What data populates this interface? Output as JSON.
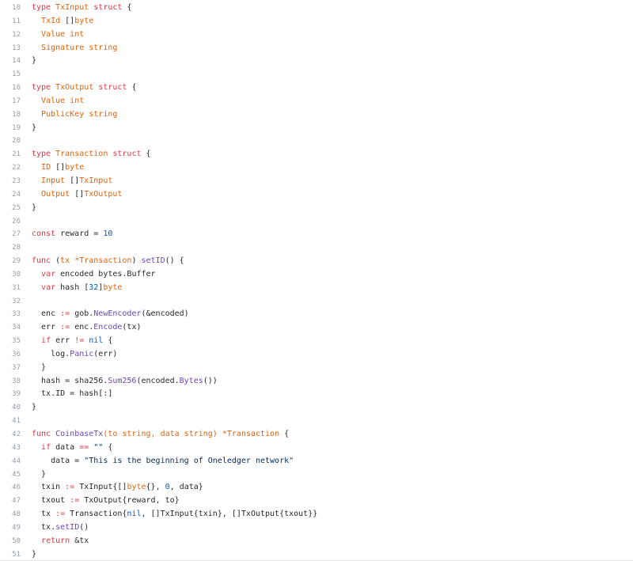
{
  "colors": {
    "keyword": "#d73a49",
    "type": "#e36209",
    "function": "#6f42c1",
    "string": "#032f62",
    "number": "#005cc5",
    "plain": "#24292e",
    "line_number": "#959da5"
  },
  "lines": [
    {
      "n": "10",
      "tokens": [
        [
          "kw",
          "type "
        ],
        [
          "ty",
          "TxInput "
        ],
        [
          "kw",
          "struct "
        ],
        [
          "pl",
          "{"
        ]
      ]
    },
    {
      "n": "11",
      "tokens": [
        [
          "pl",
          "  "
        ],
        [
          "ty",
          "TxId "
        ],
        [
          "pl",
          "[]"
        ],
        [
          "ty",
          "byte"
        ]
      ]
    },
    {
      "n": "12",
      "tokens": [
        [
          "pl",
          "  "
        ],
        [
          "ty",
          "Value "
        ],
        [
          "ty",
          "int"
        ]
      ]
    },
    {
      "n": "13",
      "tokens": [
        [
          "pl",
          "  "
        ],
        [
          "ty",
          "Signature "
        ],
        [
          "ty",
          "string"
        ]
      ]
    },
    {
      "n": "14",
      "tokens": [
        [
          "pl",
          "}"
        ]
      ]
    },
    {
      "n": "15",
      "tokens": []
    },
    {
      "n": "16",
      "tokens": [
        [
          "kw",
          "type "
        ],
        [
          "ty",
          "TxOutput "
        ],
        [
          "kw",
          "struct "
        ],
        [
          "pl",
          "{"
        ]
      ]
    },
    {
      "n": "17",
      "tokens": [
        [
          "pl",
          "  "
        ],
        [
          "ty",
          "Value "
        ],
        [
          "ty",
          "int"
        ]
      ]
    },
    {
      "n": "18",
      "tokens": [
        [
          "pl",
          "  "
        ],
        [
          "ty",
          "PublicKey "
        ],
        [
          "ty",
          "string"
        ]
      ]
    },
    {
      "n": "19",
      "tokens": [
        [
          "pl",
          "}"
        ]
      ]
    },
    {
      "n": "20",
      "tokens": []
    },
    {
      "n": "21",
      "tokens": [
        [
          "kw",
          "type "
        ],
        [
          "ty",
          "Transaction "
        ],
        [
          "kw",
          "struct "
        ],
        [
          "pl",
          "{"
        ]
      ]
    },
    {
      "n": "22",
      "tokens": [
        [
          "pl",
          "  "
        ],
        [
          "ty",
          "ID "
        ],
        [
          "pl",
          "[]"
        ],
        [
          "ty",
          "byte"
        ]
      ]
    },
    {
      "n": "23",
      "tokens": [
        [
          "pl",
          "  "
        ],
        [
          "ty",
          "Input "
        ],
        [
          "pl",
          "[]"
        ],
        [
          "ty",
          "TxInput"
        ]
      ]
    },
    {
      "n": "24",
      "tokens": [
        [
          "pl",
          "  "
        ],
        [
          "ty",
          "Output "
        ],
        [
          "pl",
          "[]"
        ],
        [
          "ty",
          "TxOutput"
        ]
      ]
    },
    {
      "n": "25",
      "tokens": [
        [
          "pl",
          "}"
        ]
      ]
    },
    {
      "n": "26",
      "tokens": []
    },
    {
      "n": "27",
      "tokens": [
        [
          "kw",
          "const "
        ],
        [
          "pl",
          "reward = "
        ],
        [
          "nu",
          "10"
        ]
      ]
    },
    {
      "n": "28",
      "tokens": []
    },
    {
      "n": "29",
      "tokens": [
        [
          "kw",
          "func "
        ],
        [
          "pl",
          "("
        ],
        [
          "ty",
          "tx *Transaction"
        ],
        [
          "pl",
          ") "
        ],
        [
          "fn",
          "setID"
        ],
        [
          "pl",
          "() {"
        ]
      ]
    },
    {
      "n": "30",
      "tokens": [
        [
          "pl",
          "  "
        ],
        [
          "kw",
          "var "
        ],
        [
          "pl",
          "encoded bytes.Buffer"
        ]
      ]
    },
    {
      "n": "31",
      "tokens": [
        [
          "pl",
          "  "
        ],
        [
          "kw",
          "var "
        ],
        [
          "pl",
          "hash ["
        ],
        [
          "nu",
          "32"
        ],
        [
          "pl",
          "]"
        ],
        [
          "ty",
          "byte"
        ]
      ]
    },
    {
      "n": "32",
      "tokens": []
    },
    {
      "n": "33",
      "tokens": [
        [
          "pl",
          "  enc "
        ],
        [
          "kw",
          ":= "
        ],
        [
          "pl",
          "gob."
        ],
        [
          "fn",
          "NewEncoder"
        ],
        [
          "pl",
          "(&encoded)"
        ]
      ]
    },
    {
      "n": "34",
      "tokens": [
        [
          "pl",
          "  err "
        ],
        [
          "kw",
          ":= "
        ],
        [
          "pl",
          "enc."
        ],
        [
          "fn",
          "Encode"
        ],
        [
          "pl",
          "(tx)"
        ]
      ]
    },
    {
      "n": "35",
      "tokens": [
        [
          "pl",
          "  "
        ],
        [
          "kw",
          "if "
        ],
        [
          "pl",
          "err "
        ],
        [
          "kw",
          "!= "
        ],
        [
          "nu",
          "nil "
        ],
        [
          "pl",
          "{"
        ]
      ]
    },
    {
      "n": "36",
      "tokens": [
        [
          "pl",
          "    log."
        ],
        [
          "fn",
          "Panic"
        ],
        [
          "pl",
          "(err)"
        ]
      ]
    },
    {
      "n": "37",
      "tokens": [
        [
          "pl",
          "  }"
        ]
      ]
    },
    {
      "n": "38",
      "tokens": [
        [
          "pl",
          "  hash = sha256."
        ],
        [
          "fn",
          "Sum256"
        ],
        [
          "pl",
          "(encoded."
        ],
        [
          "fn",
          "Bytes"
        ],
        [
          "pl",
          "())"
        ]
      ]
    },
    {
      "n": "39",
      "tokens": [
        [
          "pl",
          "  tx.ID = hash[:]"
        ]
      ]
    },
    {
      "n": "40",
      "tokens": [
        [
          "pl",
          "}"
        ]
      ]
    },
    {
      "n": "41",
      "tokens": []
    },
    {
      "n": "42",
      "tokens": [
        [
          "kw",
          "func "
        ],
        [
          "fn",
          "CoinbaseTx"
        ],
        [
          "ty",
          "(to string, data string) *Transaction "
        ],
        [
          "pl",
          "{"
        ]
      ]
    },
    {
      "n": "43",
      "tokens": [
        [
          "pl",
          "  "
        ],
        [
          "kw",
          "if "
        ],
        [
          "pl",
          "data "
        ],
        [
          "kw",
          "== "
        ],
        [
          "st",
          "\"\" "
        ],
        [
          "pl",
          "{"
        ]
      ]
    },
    {
      "n": "44",
      "tokens": [
        [
          "pl",
          "    data = "
        ],
        [
          "st",
          "\"This is the beginning of Oneledger network\""
        ]
      ]
    },
    {
      "n": "45",
      "tokens": [
        [
          "pl",
          "  }"
        ]
      ]
    },
    {
      "n": "46",
      "tokens": [
        [
          "pl",
          "  txin "
        ],
        [
          "kw",
          ":= "
        ],
        [
          "pl",
          "TxInput{[]"
        ],
        [
          "ty",
          "byte"
        ],
        [
          "pl",
          "{}, "
        ],
        [
          "nu",
          "0"
        ],
        [
          "pl",
          ", data}"
        ]
      ]
    },
    {
      "n": "47",
      "tokens": [
        [
          "pl",
          "  txout "
        ],
        [
          "kw",
          ":= "
        ],
        [
          "pl",
          "TxOutput{reward, to}"
        ]
      ]
    },
    {
      "n": "48",
      "tokens": [
        [
          "pl",
          "  tx "
        ],
        [
          "kw",
          ":= "
        ],
        [
          "pl",
          "Transaction{"
        ],
        [
          "nu",
          "nil"
        ],
        [
          "pl",
          ", []TxInput{txin}, []TxOutput{txout}}"
        ]
      ]
    },
    {
      "n": "49",
      "tokens": [
        [
          "pl",
          "  tx."
        ],
        [
          "fn",
          "setID"
        ],
        [
          "pl",
          "()"
        ]
      ]
    },
    {
      "n": "50",
      "tokens": [
        [
          "pl",
          "  "
        ],
        [
          "kw",
          "return "
        ],
        [
          "pl",
          "&tx"
        ]
      ]
    },
    {
      "n": "51",
      "tokens": [
        [
          "pl",
          "}"
        ]
      ]
    }
  ]
}
